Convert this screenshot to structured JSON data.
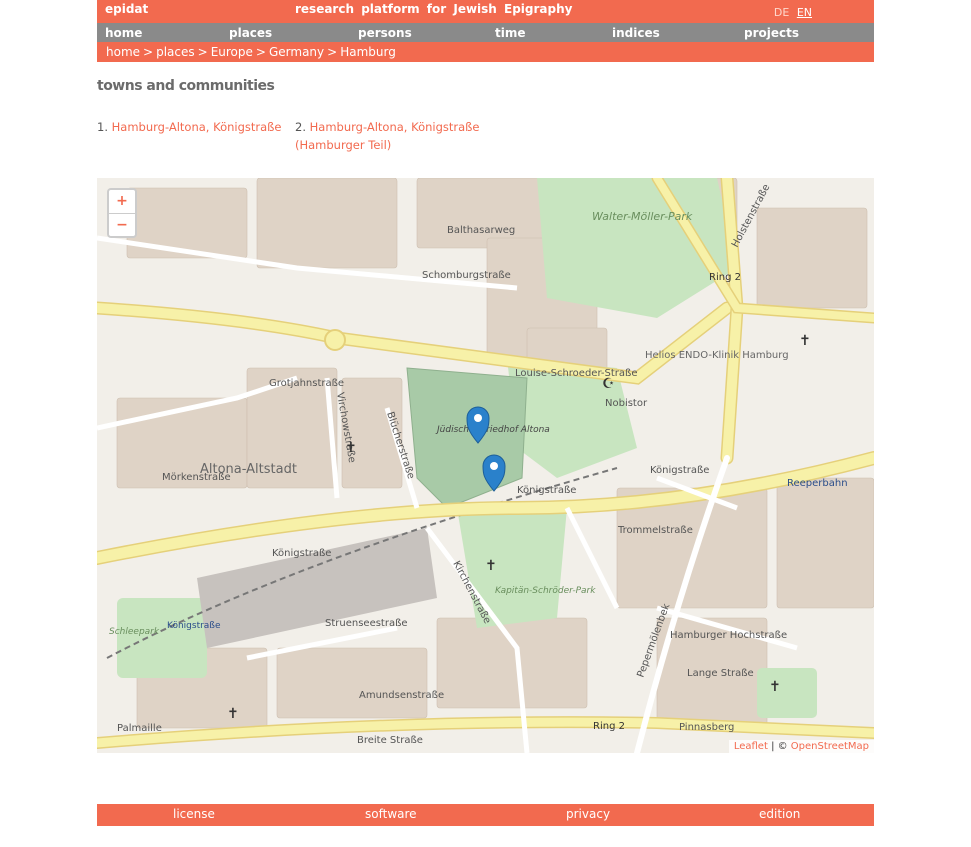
{
  "header": {
    "brand": "epidat",
    "tagline": "research platform for Jewish Epigraphy",
    "lang": [
      "DE",
      "EN"
    ]
  },
  "nav": [
    "home",
    "places",
    "persons",
    "time",
    "indices",
    "projects"
  ],
  "breadcrumb": [
    "home",
    "places",
    "Europe",
    "Germany",
    "Hamburg"
  ],
  "section_title": "towns and communities",
  "results": [
    {
      "num": "1.",
      "label": "Hamburg-Altona, Königstraße"
    },
    {
      "num": "2.",
      "label": "Hamburg-Altona, Königstraße (Hamburger Teil)"
    }
  ],
  "map": {
    "zoom_in": "+",
    "zoom_out": "−",
    "attribution_leaflet": "Leaflet",
    "attribution_sep": " | © ",
    "attribution_osm": "OpenStreetMap",
    "labels": {
      "altona_altstadt": "Altona-Altstadt",
      "walter_moeller_park": "Walter-Möller-Park",
      "juedischer_friedhof": "Jüdischer Friedhof Altona",
      "helios": "Helios ENDO-Klinik Hamburg",
      "reeperbahn": "Reeperbahn",
      "kapitan_schroeder_park": "Kapitän-Schröder-Park",
      "schleepark": "Schleepark",
      "koenigstrasse_station": "Königstraße",
      "ring2_top": "Ring 2",
      "ring2_bottom": "Ring 2",
      "koenigstrasse_1": "Königstraße",
      "koenigstrasse_2": "Königstraße",
      "koenigstrasse_3": "Königstraße",
      "louise_schroeder": "Louise-Schroeder-Straße",
      "holstenstrasse": "Holstenstraße",
      "nobistor": "Nobistor",
      "breite_strasse": "Breite Straße",
      "palmaille": "Palmaille",
      "struenseestrasse": "Struenseestraße",
      "amundsenstrasse": "Amundsenstraße",
      "schomburgstrasse": "Schomburgstraße",
      "balthasarweg": "Balthasarweg",
      "grotjahnstrasse": "Grotjahnstraße",
      "morkenstrasse": "Mörkenstraße",
      "pepermoelenbek": "Pepermölenbek",
      "trommelstrasse": "Trommelstraße",
      "hamburger_hochstrasse": "Hamburger Hochstraße",
      "lange_strasse": "Lange Straße",
      "pinnasberg": "Pinnasberg",
      "blucherstrasse": "Blücherstraße",
      "virchowstrasse": "Virchowstraße",
      "kirchenstrasse": "Kirchenstraße"
    }
  },
  "footer": [
    "license",
    "software",
    "privacy",
    "edition"
  ],
  "colors": {
    "accent": "#f26a4f",
    "nav": "#8a8a8a",
    "marker": "#2a81cb"
  }
}
